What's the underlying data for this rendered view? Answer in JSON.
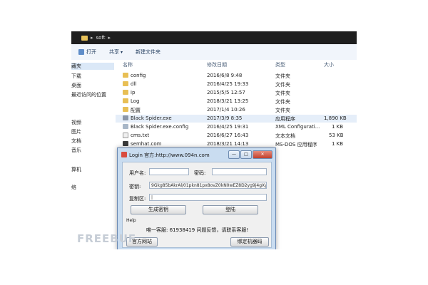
{
  "address_bar": {
    "crumb": "soft",
    "sep1": "▸",
    "sep2": "▸"
  },
  "toolbar": {
    "open": "打开",
    "share": "共享",
    "share_chev": "▾",
    "new_folder": "新建文件夹"
  },
  "nav_pane": {
    "items": [
      "藏夹",
      "下载",
      "桌面",
      "最近访问的位置",
      "视频",
      "图片",
      "文档",
      "音乐",
      "算机",
      "络"
    ]
  },
  "file_list": {
    "headers": {
      "name": "名称",
      "modified": "修改日期",
      "type": "类型",
      "size": "大小"
    },
    "rows": [
      {
        "name": "config",
        "date": "2016/6/8 9:48",
        "type": "文件夹",
        "size": "",
        "icon": "folder-icon"
      },
      {
        "name": "dll",
        "date": "2016/4/25 19:33",
        "type": "文件夹",
        "size": "",
        "icon": "folder-icon"
      },
      {
        "name": "ip",
        "date": "2015/5/5 12:57",
        "type": "文件夹",
        "size": "",
        "icon": "folder-icon"
      },
      {
        "name": "Log",
        "date": "2018/3/21 13:25",
        "type": "文件夹",
        "size": "",
        "icon": "folder-icon"
      },
      {
        "name": "配置",
        "date": "2017/1/4 10:26",
        "type": "文件夹",
        "size": "",
        "icon": "folder-icon"
      },
      {
        "name": "Black Spider.exe",
        "date": "2017/3/9 8:35",
        "type": "应用程序",
        "size": "1,890 KB",
        "icon": "exe-icon"
      },
      {
        "name": "Black Spider.exe.config",
        "date": "2016/4/25 19:31",
        "type": "XML Configurati...",
        "size": "1 KB",
        "icon": "config-file-icon"
      },
      {
        "name": "cms.txt",
        "date": "2016/6/27 16:43",
        "type": "文本文档",
        "size": "53 KB",
        "icon": "text-file-icon"
      },
      {
        "name": "semhat.com",
        "date": "2018/3/21 14:13",
        "type": "MS-DOS 应用程序",
        "size": "1 KB",
        "icon": "dos-app-icon"
      }
    ]
  },
  "dialog": {
    "title": "Login 官方:http://www.094n.com",
    "minimize": "—",
    "maximize": "□",
    "close": "✕",
    "username_label": "用户名:",
    "username_value": "",
    "password_label": "密码:",
    "password_value": "",
    "key_label": "密钥:",
    "key_value": "9Gkg85bAkrAl/01pkn81px8ovZ0kN0wEZ8D2yg9j4gXy#Jn",
    "copy_label": "复制区:",
    "copy_value": "|",
    "generate_key_button": "生成密钥",
    "login_button": "登陆",
    "help_text": "Help",
    "support_text": "唯一客服: 61938419   问题反馈，请联系客服!",
    "official_site_button": "官方网站",
    "bind_machine_button": "绑定机器码"
  },
  "watermark": "FREEBUF",
  "colors": {
    "accent": "#6a89b3",
    "dialog_frame": "#c9dcf0",
    "selection": "#e5eef9"
  }
}
